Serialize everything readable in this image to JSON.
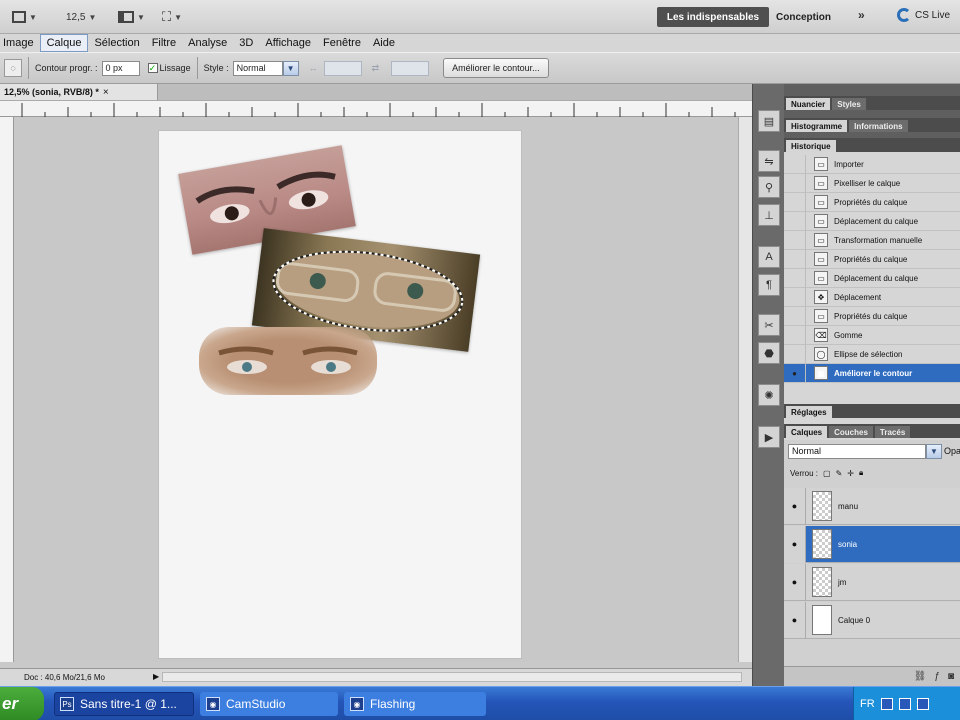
{
  "appbar": {
    "zoom": "12,5",
    "workspace_active": "Les indispensables",
    "workspace_other": "Conception",
    "more": "»",
    "cs_live": "CS Live"
  },
  "menu": [
    "Image",
    "Calque",
    "Sélection",
    "Filtre",
    "Analyse",
    "3D",
    "Affichage",
    "Fenêtre",
    "Aide"
  ],
  "options": {
    "feather_label": "Contour progr. :",
    "feather_value": "0 px",
    "antialias_label": "Lissage",
    "style_label": "Style :",
    "style_value": "Normal",
    "refine_button": "Améliorer le contour..."
  },
  "document": {
    "tab_title": "12,5% (sonia, RVB/8) *",
    "status": "Doc : 40,6 Mo/21,6 Mo"
  },
  "panels": {
    "row1_tabs": [
      "Nuancier",
      "Styles"
    ],
    "row2_tabs": [
      "Histogramme",
      "Informations"
    ],
    "history_tab": "Historique",
    "history_items": [
      {
        "label": "Importer",
        "icon": "document-icon"
      },
      {
        "label": "Pixelliser le calque",
        "icon": "document-icon"
      },
      {
        "label": "Propriétés du calque",
        "icon": "document-icon"
      },
      {
        "label": "Déplacement du calque",
        "icon": "document-icon"
      },
      {
        "label": "Transformation manuelle",
        "icon": "document-icon"
      },
      {
        "label": "Propriétés du calque",
        "icon": "document-icon"
      },
      {
        "label": "Déplacement du calque",
        "icon": "document-icon"
      },
      {
        "label": "Déplacement",
        "icon": "move-icon"
      },
      {
        "label": "Propriétés du calque",
        "icon": "document-icon"
      },
      {
        "label": "Gomme",
        "icon": "eraser-icon"
      },
      {
        "label": "Ellipse de sélection",
        "icon": "ellipse-icon"
      },
      {
        "label": "Améliorer le contour",
        "icon": "refine-icon"
      }
    ],
    "adjust_tab": "Réglages",
    "layer_tabs": [
      "Calques",
      "Couches",
      "Tracés"
    ],
    "blend_mode": "Normal",
    "opacity_label": "Opa",
    "lock_label": "Verrou :",
    "layers": [
      {
        "name": "manu",
        "selected": false
      },
      {
        "name": "sonia",
        "selected": true
      },
      {
        "name": "jm",
        "selected": false
      },
      {
        "name": "Calque 0",
        "selected": false
      }
    ]
  },
  "taskbar": {
    "start": "er",
    "tasks": [
      "Sans titre-1 @ 1...",
      "CamStudio",
      "Flashing"
    ],
    "lang": "FR"
  },
  "colors": {
    "selection_blue": "#2f6cc0",
    "taskbar_blue": "#2455b8"
  }
}
